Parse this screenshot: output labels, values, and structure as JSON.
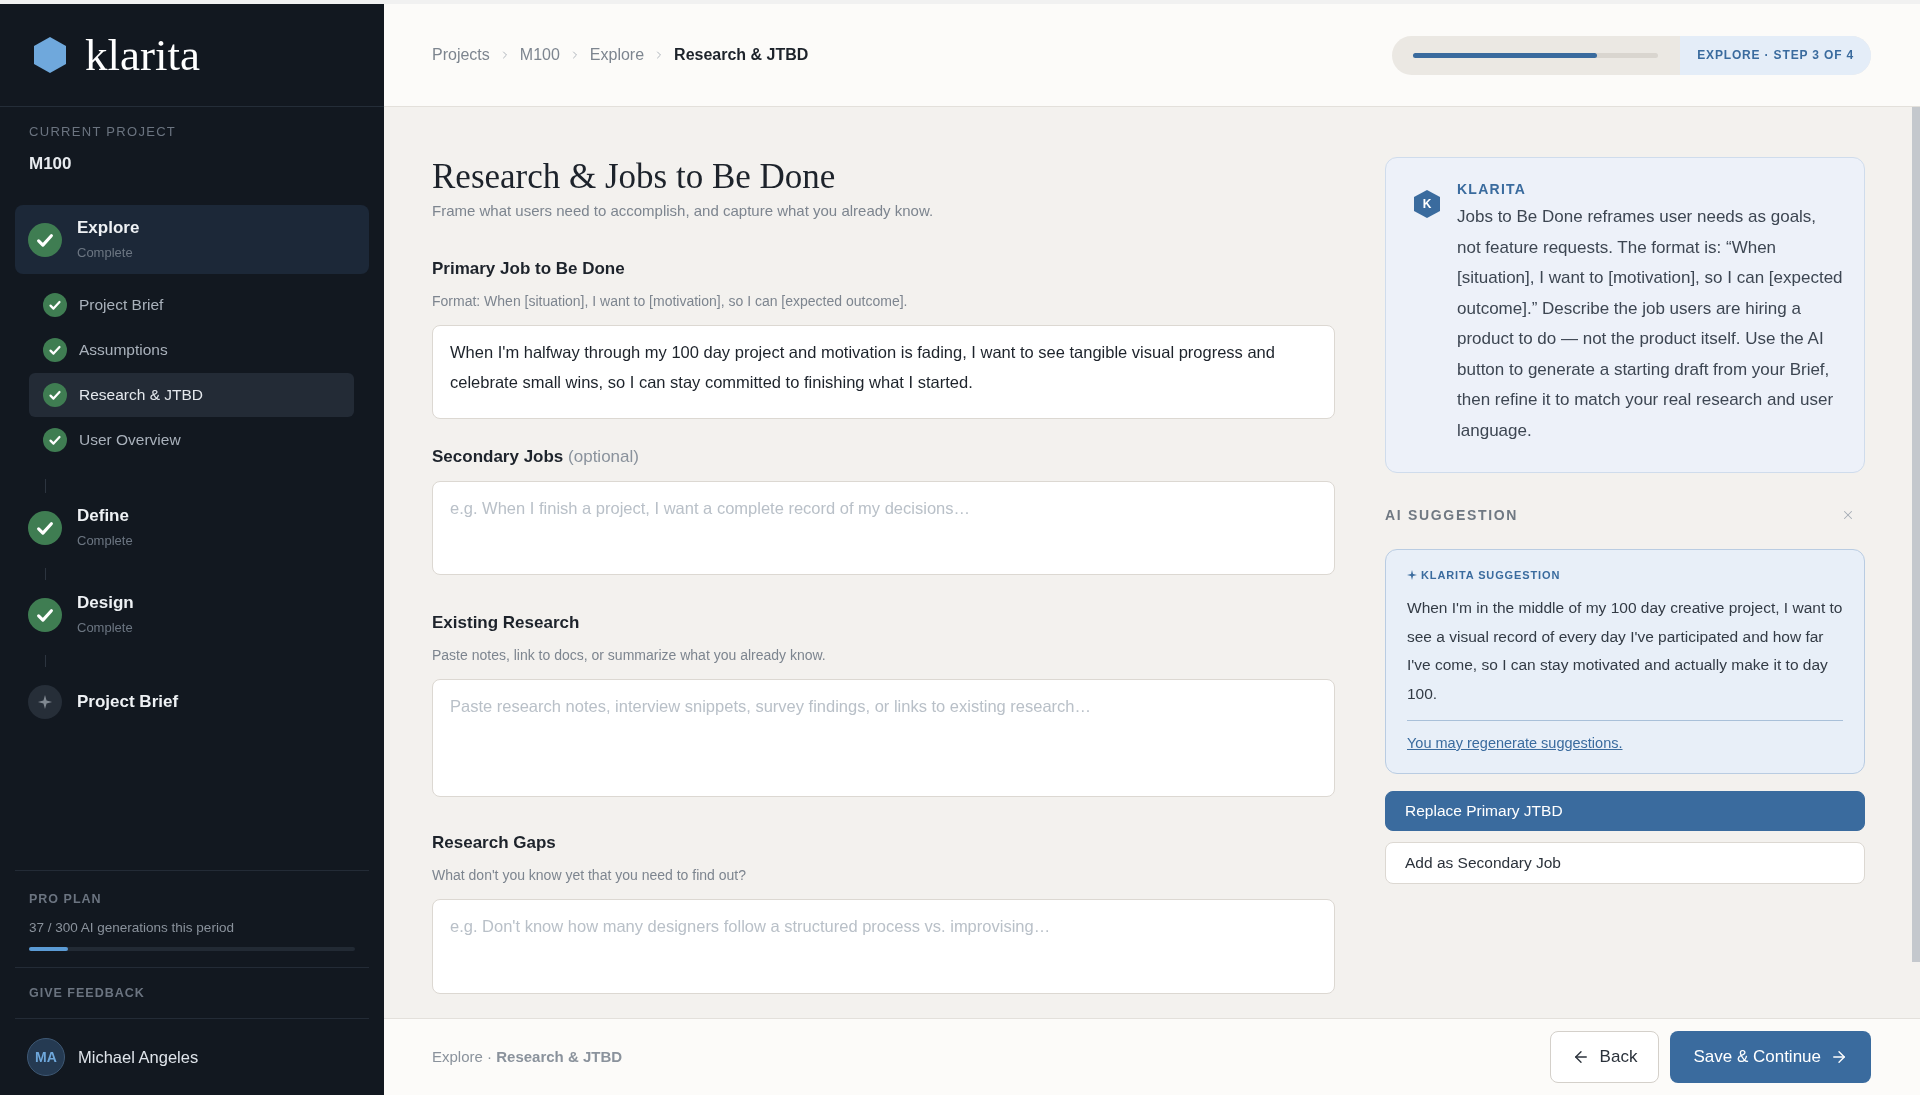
{
  "sidebar": {
    "logo": "klarita",
    "project_label": "CURRENT PROJECT",
    "project_name": "M100",
    "phases": [
      {
        "title": "Explore",
        "status": "Complete",
        "completed": true,
        "selected": true,
        "children": [
          {
            "label": "Project Brief",
            "completed": true,
            "selected": false
          },
          {
            "label": "Assumptions",
            "completed": true,
            "selected": false
          },
          {
            "label": "Research & JTBD",
            "completed": true,
            "selected": true
          },
          {
            "label": "User Overview",
            "completed": true,
            "selected": false
          }
        ]
      },
      {
        "title": "Define",
        "status": "Complete",
        "completed": true,
        "selected": false
      },
      {
        "title": "Design",
        "status": "Complete",
        "completed": true,
        "selected": false
      },
      {
        "title": "Project Brief",
        "completed": false,
        "selected": false
      }
    ],
    "plan": {
      "label": "PRO PLAN",
      "usage": "37 / 300 AI generations this period",
      "level": 0.12
    },
    "feedback": "GIVE FEEDBACK",
    "user": {
      "initials": "MA",
      "name": "Michael Angeles"
    }
  },
  "header": {
    "breadcrumbs": [
      {
        "label": "Projects",
        "current": false
      },
      {
        "label": "M100",
        "current": false
      },
      {
        "label": "Explore",
        "current": false
      },
      {
        "label": "Research & JTBD",
        "current": true
      }
    ],
    "progress": {
      "level": 0.75,
      "label": "EXPLORE · STEP 3 OF 4"
    }
  },
  "form": {
    "title": "Research & Jobs to Be Done",
    "subtitle": "Frame what users need to accomplish, and capture what you already know.",
    "fields": [
      {
        "label": "Primary Job to Be Done",
        "hint": "Format: When [situation], I want to [motivation], so I can [expected outcome].",
        "value": "When I'm halfway through my 100 day project and motivation is fading, I want to see tangible visual progress and celebrate small wins, so I can stay committed to finishing what I started."
      },
      {
        "label": "Secondary Jobs",
        "note": "(optional)",
        "placeholder": "e.g. When I finish a project, I want a complete record of my decisions…"
      },
      {
        "label": "Existing Research",
        "hint": "Paste notes, link to docs, or summarize what you already know.",
        "placeholder": "Paste research notes, interview snippets, survey findings, or links to existing research…"
      },
      {
        "label": "Research Gaps",
        "hint": "What don't you know yet that you need to find out?",
        "placeholder": "e.g. Don't know how many designers follow a structured process vs. improvising…"
      }
    ]
  },
  "assistant": {
    "avatar": "K",
    "name": "KLARITA",
    "message": "Jobs to Be Done reframes user needs as goals, not feature requests. The format is: “When [situation], I want to [motivation], so I can [expected outcome].” Describe the job users are hiring a product to do — not the product itself. Use the AI button to generate a starting draft from your Brief, then refine it to match your real research and user language."
  },
  "suggestion": {
    "heading": "AI SUGGESTION",
    "label": "KLARITA SUGGESTION",
    "text": "When I'm in the middle of my 100 day creative project, I want to see a visual record of every day I've participated and how far I've come, so I can stay motivated and actually make it to day 100.",
    "link": "You may regenerate suggestions.",
    "actions": [
      {
        "label": "Replace Primary JTBD",
        "kind": "primary"
      },
      {
        "label": "Add as Secondary Job",
        "kind": "secondary"
      }
    ]
  },
  "footer": {
    "trail": "Explore · **Research & JTBD**",
    "actions": [
      {
        "label": "Back",
        "kind": "back"
      },
      {
        "label": "Save & Continue",
        "kind": "next"
      }
    ]
  }
}
